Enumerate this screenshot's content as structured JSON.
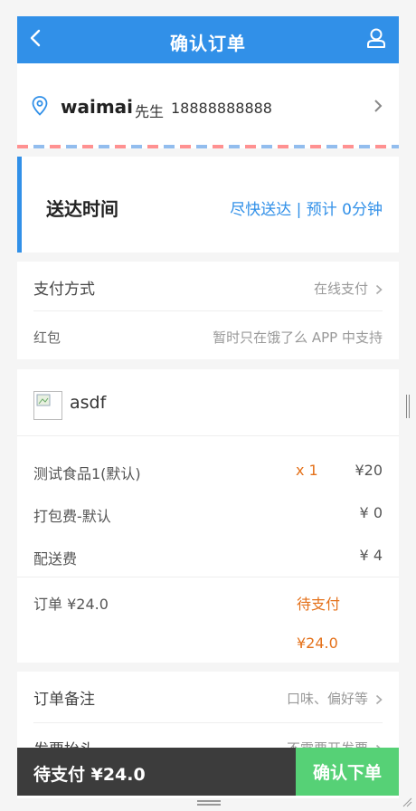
{
  "header": {
    "title": "确认订单",
    "back_icon": "chevron-left-icon",
    "user_icon": "user-icon",
    "color": "#3190e8"
  },
  "address": {
    "icon": "location-pin-icon",
    "name": "waimai",
    "sex": "先生",
    "phone": "18888888888"
  },
  "delivery": {
    "label": "送达时间",
    "value": "尽快送达 | 预计 0分钟"
  },
  "payment": {
    "method_label": "支付方式",
    "method_value": "在线支付",
    "redpacket_label": "红包",
    "redpacket_value": "暂时只在饿了么 APP 中支持"
  },
  "shop": {
    "name": "asdf",
    "items": [
      {
        "name": "测试食品1(默认)",
        "qty": "x 1",
        "price": "¥20"
      },
      {
        "name": "打包费-默认",
        "qty": "",
        "price": "¥ 0"
      },
      {
        "name": "配送费",
        "qty": "",
        "price": "¥ 4"
      }
    ],
    "order_total": "订单 ¥24.0",
    "pending_label": "待支付",
    "pending_amount": "¥24.0"
  },
  "remark": {
    "label": "订单备注",
    "value": "口味、偏好等",
    "invoice_label": "发票抬头",
    "invoice_value": "不需要开发票"
  },
  "footer": {
    "pending_total": "待支付 ¥24.0",
    "confirm_label": "确认下单",
    "confirm_color": "#56d176"
  }
}
